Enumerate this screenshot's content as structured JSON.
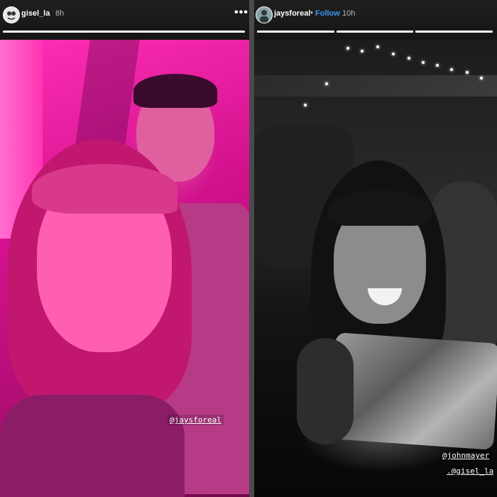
{
  "stories": [
    {
      "username": "gisel_la",
      "time": "8h",
      "more_icon": "more-icon",
      "progress_segments": 1,
      "tag": "@jaysforeal"
    },
    {
      "username": "jaysforeal",
      "separator": "•",
      "follow_label": "Follow",
      "time": "10h",
      "progress_segments": 3,
      "tags": [
        "@johnmayer",
        ".@gisel_la"
      ]
    }
  ],
  "colors": {
    "follow": "#3897f0",
    "left_tint": "#e0169a",
    "header_bg": "#1a1a1a"
  },
  "icons": [
    "avatar-icon",
    "more-icon"
  ]
}
